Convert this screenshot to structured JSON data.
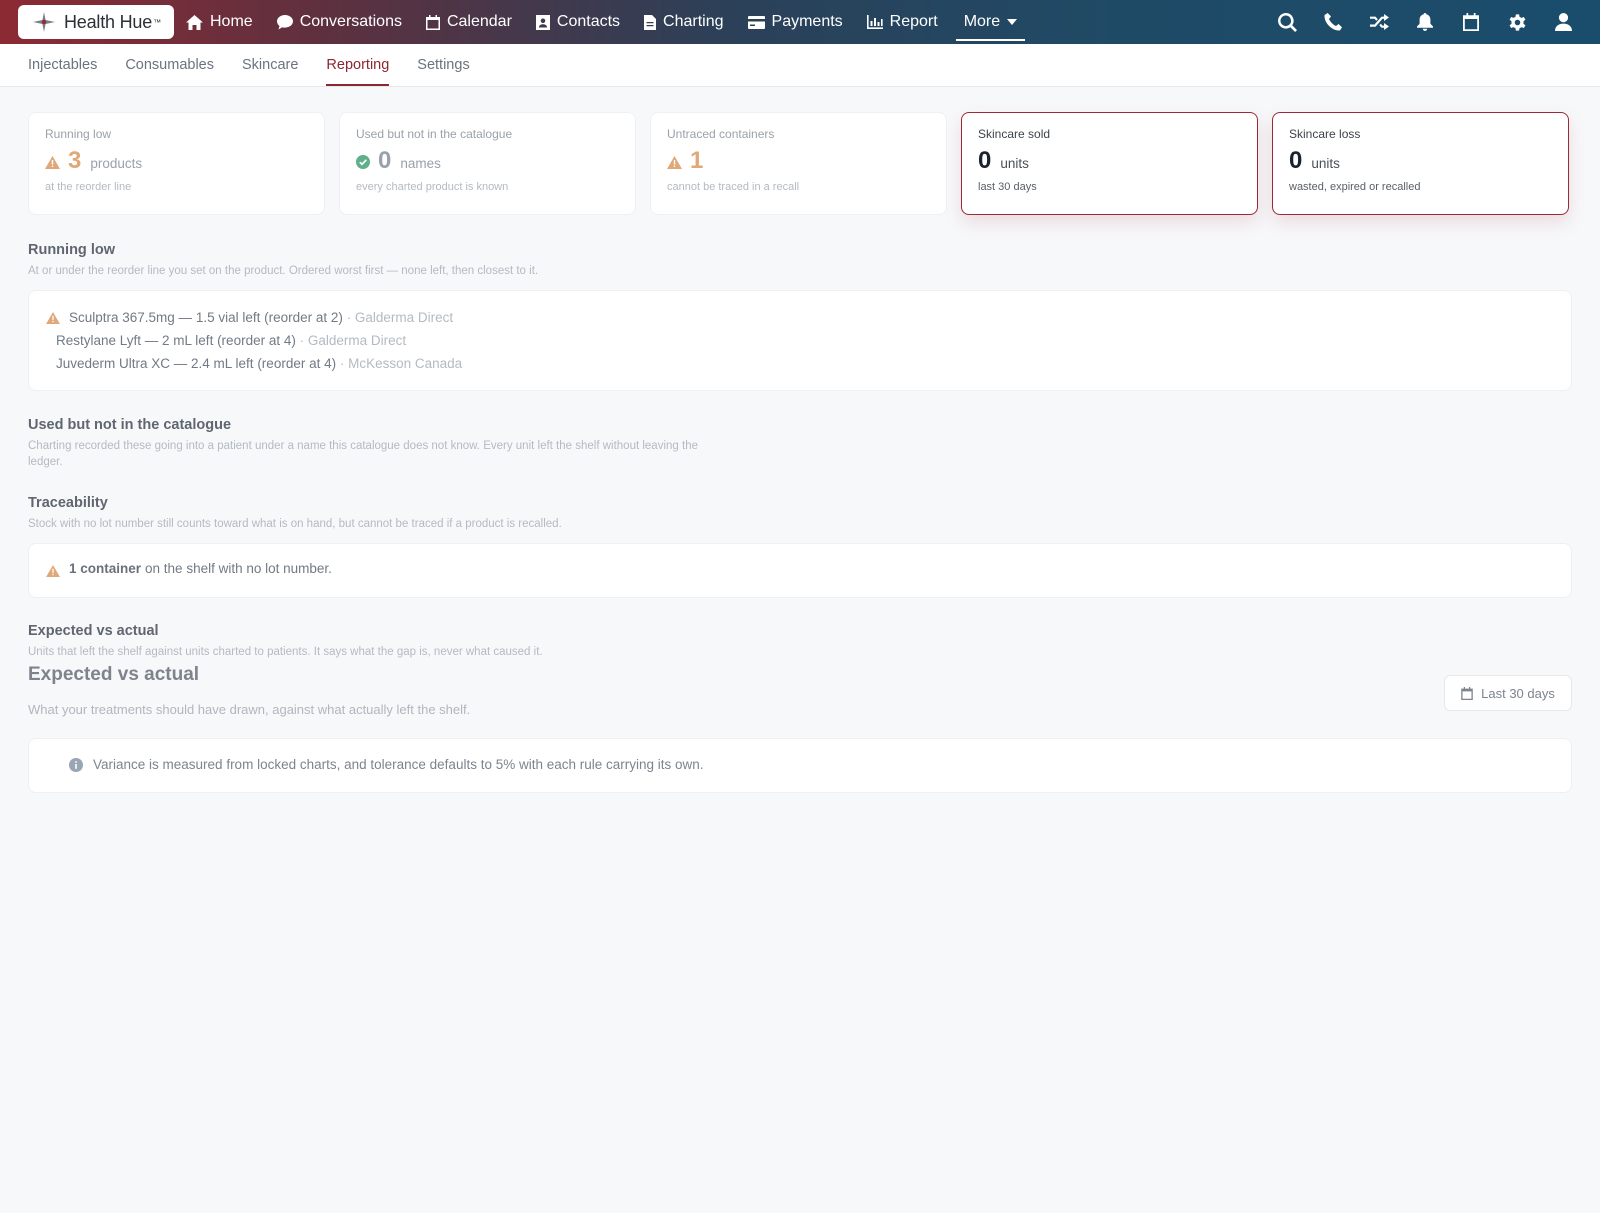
{
  "brand": {
    "name": "Health Hue",
    "mark": "™"
  },
  "nav": {
    "items": [
      {
        "label": "Home",
        "icon": "home-icon"
      },
      {
        "label": "Conversations",
        "icon": "chat-icon"
      },
      {
        "label": "Calendar",
        "icon": "calendar-icon"
      },
      {
        "label": "Contacts",
        "icon": "contact-card-icon"
      },
      {
        "label": "Charting",
        "icon": "document-icon"
      },
      {
        "label": "Payments",
        "icon": "credit-card-icon"
      },
      {
        "label": "Report",
        "icon": "bar-chart-icon"
      }
    ],
    "more_label": "More",
    "right_icons": [
      "search-icon",
      "phone-icon",
      "shuffle-icon",
      "bell-icon",
      "calendar-icon",
      "gear-icon",
      "user-icon"
    ]
  },
  "subtabs": {
    "items": [
      "Injectables",
      "Consumables",
      "Skincare",
      "Reporting",
      "Settings"
    ],
    "active": "Reporting"
  },
  "cards": [
    {
      "label": "Running low",
      "value": "3",
      "unit": "products",
      "sub": "at the reorder line",
      "status": "warning"
    },
    {
      "label": "Used but not in the catalogue",
      "value": "0",
      "unit": "names",
      "sub": "every charted product is known",
      "status": "ok"
    },
    {
      "label": "Untraced containers",
      "value": "1",
      "unit": "",
      "sub": "cannot be traced in a recall",
      "status": "warning"
    },
    {
      "label": "Skincare sold",
      "value": "0",
      "unit": "units",
      "sub": "last 30 days",
      "status": "highlight"
    },
    {
      "label": "Skincare loss",
      "value": "0",
      "unit": "units",
      "sub": "wasted, expired or recalled",
      "status": "highlight"
    }
  ],
  "running_low": {
    "title": "Running low",
    "desc": "At or under the reorder line you set on the product. Ordered worst first — none left, then closest to it.",
    "items": [
      {
        "text": "Sculptra 367.5mg — 1.5 vial left (reorder at 2)",
        "supplier": " · Galderma Direct"
      },
      {
        "text": "Restylane Lyft — 2 mL left (reorder at 4)",
        "supplier": " · Galderma Direct"
      },
      {
        "text": "Juvederm Ultra XC — 2.4 mL left (reorder at 4)",
        "supplier": " · McKesson Canada"
      }
    ]
  },
  "not_in_catalogue": {
    "title": "Used but not in the catalogue",
    "desc": "Charting recorded these going into a patient under a name this catalogue does not know. Every unit left the shelf without leaving the ledger."
  },
  "traceability": {
    "title": "Traceability",
    "desc": "Stock with no lot number still counts toward what is on hand, but cannot be traced if a product is recalled.",
    "strong": "1 container",
    "rest": "on the shelf with no lot number."
  },
  "expected_vs_actual": {
    "title": "Expected vs actual",
    "desc": "Units that left the shelf against units charted to patients. It says what the gap is, never what caused it.",
    "heading": "Expected vs actual",
    "subheading": "What your treatments should have drawn, against what actually left the shelf.",
    "range_label": "Last 30 days",
    "info": "Variance is measured from locked charts, and tolerance defaults to 5% with each rule carrying its own."
  },
  "colors": {
    "accent": "#8a2730",
    "warning": "#e0a878",
    "ok": "#5fb08a",
    "info": "#9aa6b4"
  }
}
